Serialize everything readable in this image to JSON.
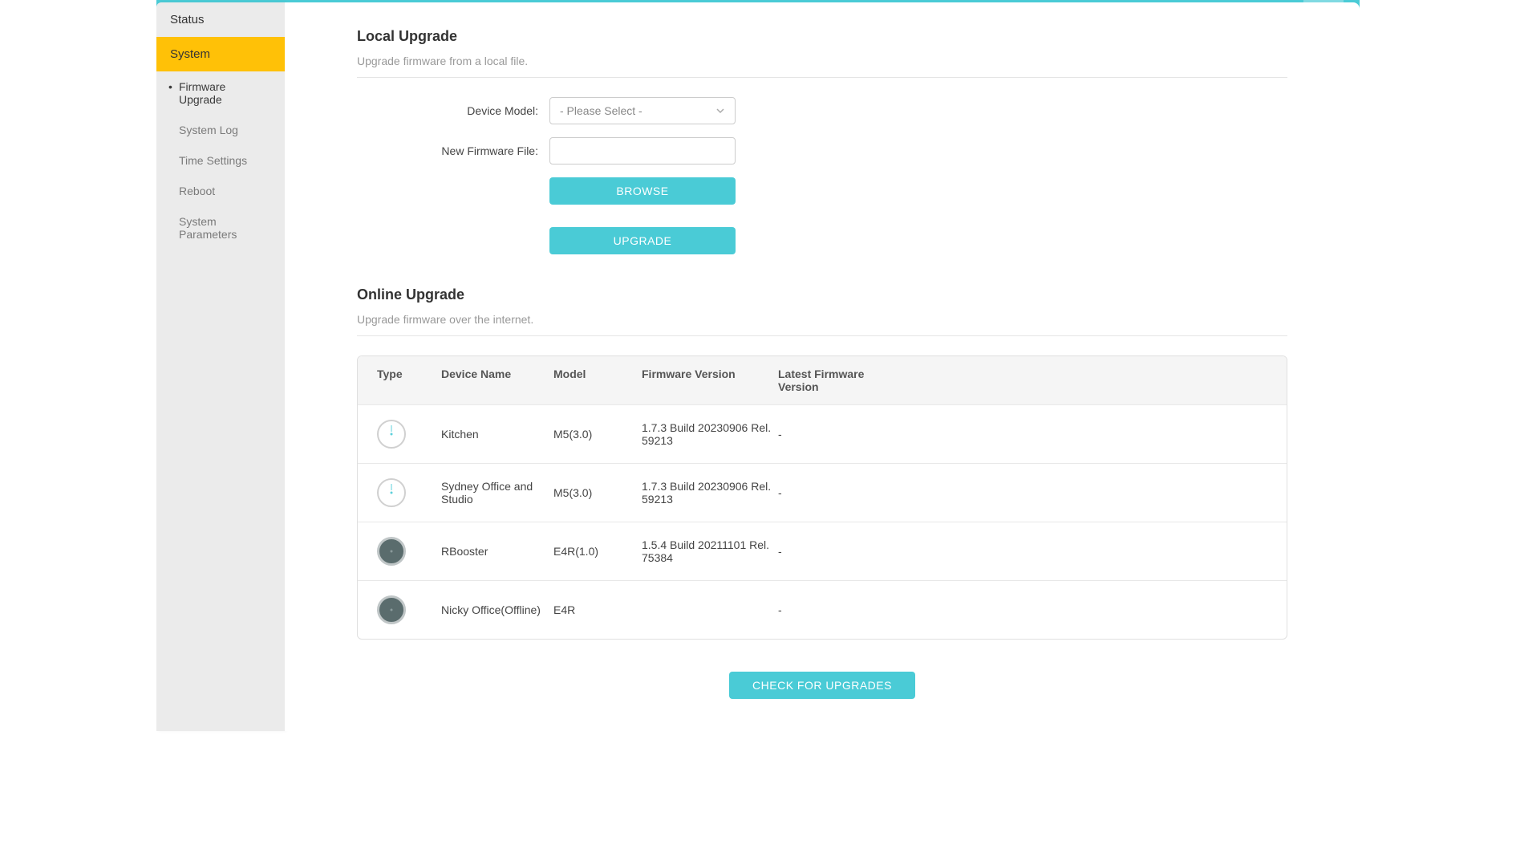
{
  "sidebar": {
    "items": [
      {
        "label": "Status",
        "type": "top"
      },
      {
        "label": "System",
        "type": "top-active"
      }
    ],
    "subitems": [
      {
        "label": "Firmware Upgrade",
        "selected": true
      },
      {
        "label": "System Log",
        "selected": false
      },
      {
        "label": "Time Settings",
        "selected": false
      },
      {
        "label": "Reboot",
        "selected": false
      },
      {
        "label": "System Parameters",
        "selected": false
      }
    ]
  },
  "localUpgrade": {
    "title": "Local Upgrade",
    "desc": "Upgrade firmware from a local file.",
    "deviceModelLabel": "Device Model:",
    "deviceModelPlaceholder": "- Please Select -",
    "firmwareFileLabel": "New Firmware File:",
    "browseBtn": "BROWSE",
    "upgradeBtn": "UPGRADE"
  },
  "onlineUpgrade": {
    "title": "Online Upgrade",
    "desc": "Upgrade firmware over the internet.",
    "columns": {
      "type": "Type",
      "deviceName": "Device Name",
      "model": "Model",
      "firmwareVersion": "Firmware Version",
      "latestFirmware": "Latest Firmware Version"
    },
    "devices": [
      {
        "iconType": "light",
        "name": "Kitchen",
        "model": "M5(3.0)",
        "fw": "1.7.3 Build 20230906 Rel. 59213",
        "latest": "-"
      },
      {
        "iconType": "light",
        "name": "Sydney Office and Studio",
        "model": "M5(3.0)",
        "fw": "1.7.3 Build 20230906 Rel. 59213",
        "latest": "-"
      },
      {
        "iconType": "dark",
        "name": "RBooster",
        "model": "E4R(1.0)",
        "fw": "1.5.4 Build 20211101 Rel. 75384",
        "latest": "-"
      },
      {
        "iconType": "dark",
        "name": "Nicky Office(Offline)",
        "model": "E4R",
        "fw": "",
        "latest": "-"
      }
    ],
    "checkBtn": "CHECK FOR UPGRADES"
  }
}
